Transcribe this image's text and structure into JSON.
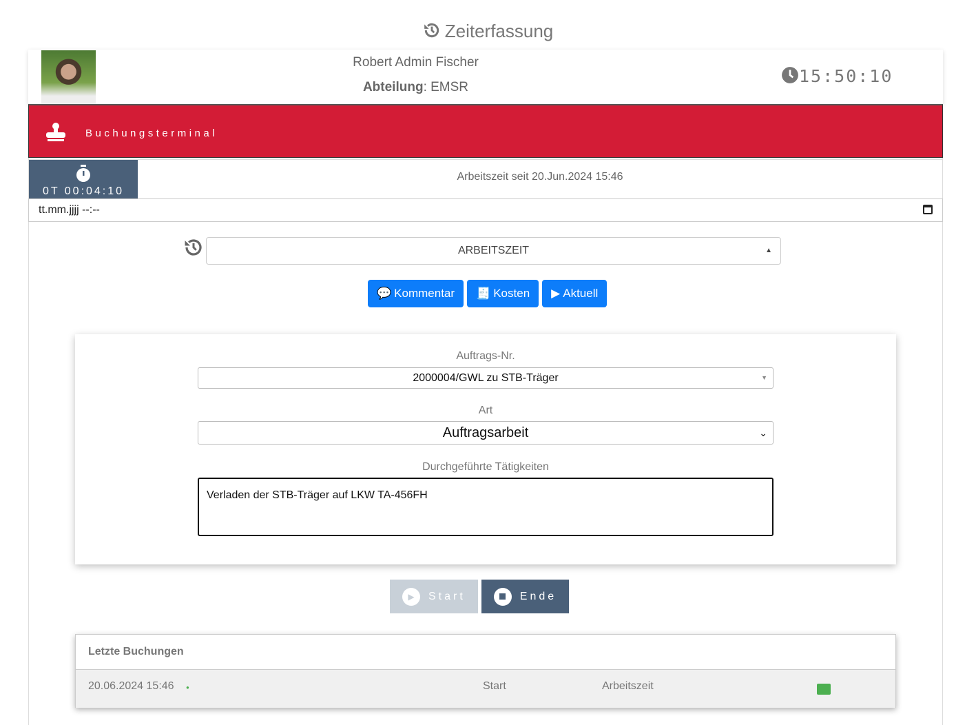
{
  "title": "Zeiterfassung",
  "user": {
    "name": "Robert Admin Fischer",
    "dept_label": "Abteilung",
    "dept_value": "EMSR"
  },
  "clock": "15:50:10",
  "terminal_label": "Buchungsterminal",
  "timer": "0T 00:04:10",
  "since": "Arbeitszeit seit 20.Jun.2024 15:46",
  "date_placeholder": "tt.mm.jjjj --:--",
  "mode_select": "ARBEITSZEIT",
  "buttons": {
    "comment": "Kommentar",
    "costs": "Kosten",
    "current": "Aktuell",
    "start": "Start",
    "end": "Ende"
  },
  "form": {
    "order_label": "Auftrags-Nr.",
    "order_value": "2000004/GWL zu STB-Träger",
    "type_label": "Art",
    "type_value": "Auftragsarbeit",
    "activities_label": "Durchgeführte Tätigkeiten",
    "activities_value": "Verladen der STB-Träger auf LKW TA-456FH"
  },
  "recent": {
    "title": "Letzte Buchungen",
    "rows": [
      {
        "datetime": "20.06.2024 15:46",
        "action": "Start",
        "type": "Arbeitszeit"
      }
    ]
  },
  "colors": {
    "brand_red": "#d31c36",
    "slate": "#4a6079",
    "primary": "#0d7dfa",
    "green": "#4caf50"
  }
}
